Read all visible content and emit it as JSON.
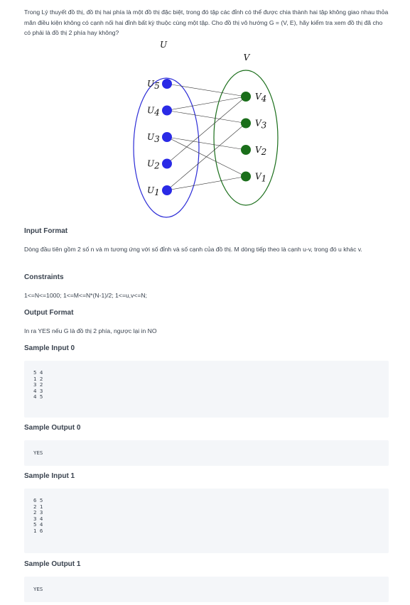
{
  "problem": {
    "intro": "Trong Lý thuyết đồ thị, đồ thị hai phía là một đồ thị đặc biệt, trong đó tập các đỉnh có thể được chia thành hai tập không giao nhau thỏa mãn điều kiện không có cạnh nối hai đỉnh bất kỳ thuộc cùng một tập. Cho đồ thị vô hướng G = (V, E), hãy kiểm tra xem đồ thị đã cho có phải là đồ thị 2 phía hay không?",
    "figure": {
      "left_set_label": "U",
      "right_set_label": "V",
      "left_vertices": [
        "U5",
        "U4",
        "U3",
        "U2",
        "U1"
      ],
      "right_vertices": [
        "V4",
        "V3",
        "V2",
        "V1"
      ],
      "left_color": "#2b2bd6",
      "right_color": "#1a6e1a",
      "edges": [
        [
          "U5",
          "V4"
        ],
        [
          "U4",
          "V4"
        ],
        [
          "U4",
          "V3"
        ],
        [
          "U3",
          "V2"
        ],
        [
          "U3",
          "V1"
        ],
        [
          "U2",
          "V4"
        ],
        [
          "U1",
          "V3"
        ],
        [
          "U1",
          "V1"
        ]
      ]
    },
    "input_format": {
      "heading": "Input Format",
      "text": "Dòng đầu tiên gồm 2 số n và m tương ứng với số đỉnh và số cạnh của đồ thị. M dòng tiếp theo là cạnh u-v, trong đó u khác v."
    },
    "constraints": {
      "heading": "Constraints",
      "text": "1<=N<=1000; 1<=M<=N*(N-1)/2; 1<=u,v<=N;"
    },
    "output_format": {
      "heading": "Output Format",
      "text": "In ra YES nếu G là đồ thị 2 phía, ngược lại in NO"
    },
    "sample_input_0": {
      "heading": "Sample Input 0",
      "lines": [
        "5 4",
        "1 2",
        "3 2",
        "4 3",
        "4 5"
      ]
    },
    "sample_output_0": {
      "heading": "Sample Output 0",
      "lines": [
        "YES"
      ]
    },
    "sample_input_1": {
      "heading": "Sample Input 1",
      "lines": [
        "6 5",
        "2 1",
        "2 3",
        "3 4",
        "5 4",
        "1 6"
      ]
    },
    "sample_output_1": {
      "heading": "Sample Output 1",
      "lines": [
        "YES"
      ]
    }
  }
}
